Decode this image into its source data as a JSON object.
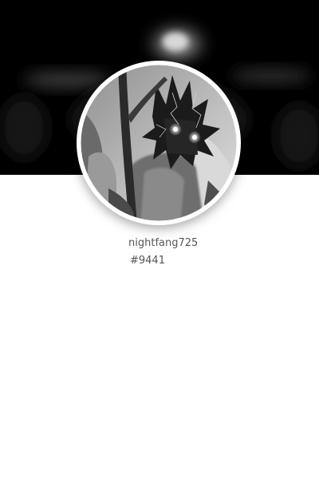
{
  "profile": {
    "username": "nightfang725",
    "discriminator": "#9441"
  },
  "colors": {
    "banner": "#000000",
    "page_background": "#ffffff",
    "avatar_border": "#ffffff",
    "text": "#555555"
  }
}
